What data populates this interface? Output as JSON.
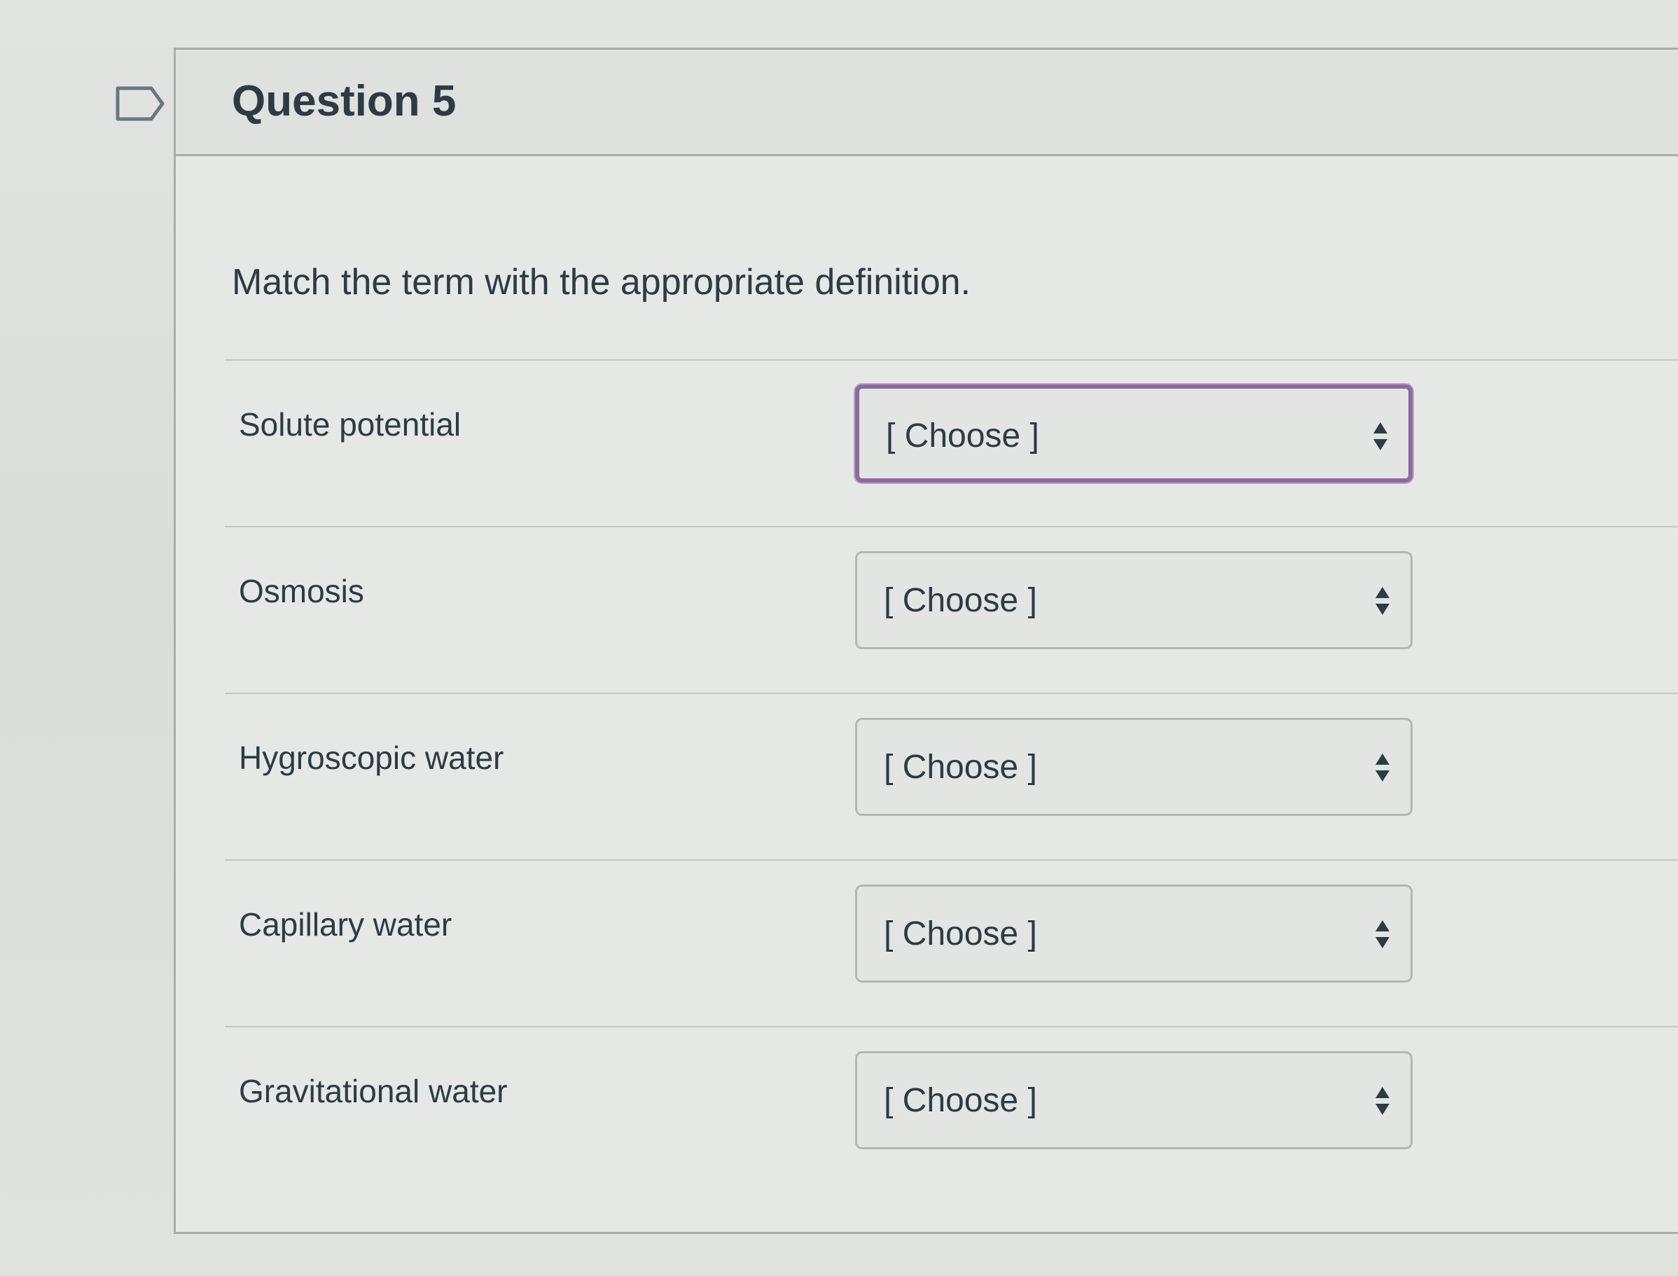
{
  "question": {
    "title": "Question 5",
    "prompt": "Match the term with the appropriate definition."
  },
  "matches": [
    {
      "term": "Solute potential",
      "selected": "[ Choose ]",
      "focused": true
    },
    {
      "term": "Osmosis",
      "selected": "[ Choose ]",
      "focused": false
    },
    {
      "term": "Hygroscopic water",
      "selected": "[ Choose ]",
      "focused": false
    },
    {
      "term": "Capillary water",
      "selected": "[ Choose ]",
      "focused": false
    },
    {
      "term": "Gravitational water",
      "selected": "[ Choose ]",
      "focused": false
    }
  ],
  "colors": {
    "text": "#2d3b45",
    "focus_border": "#8c6a9e",
    "border": "#b3b8b5"
  },
  "icons": {
    "flag": "flag-outline-icon",
    "select_arrows": "up-down-arrows-icon"
  }
}
